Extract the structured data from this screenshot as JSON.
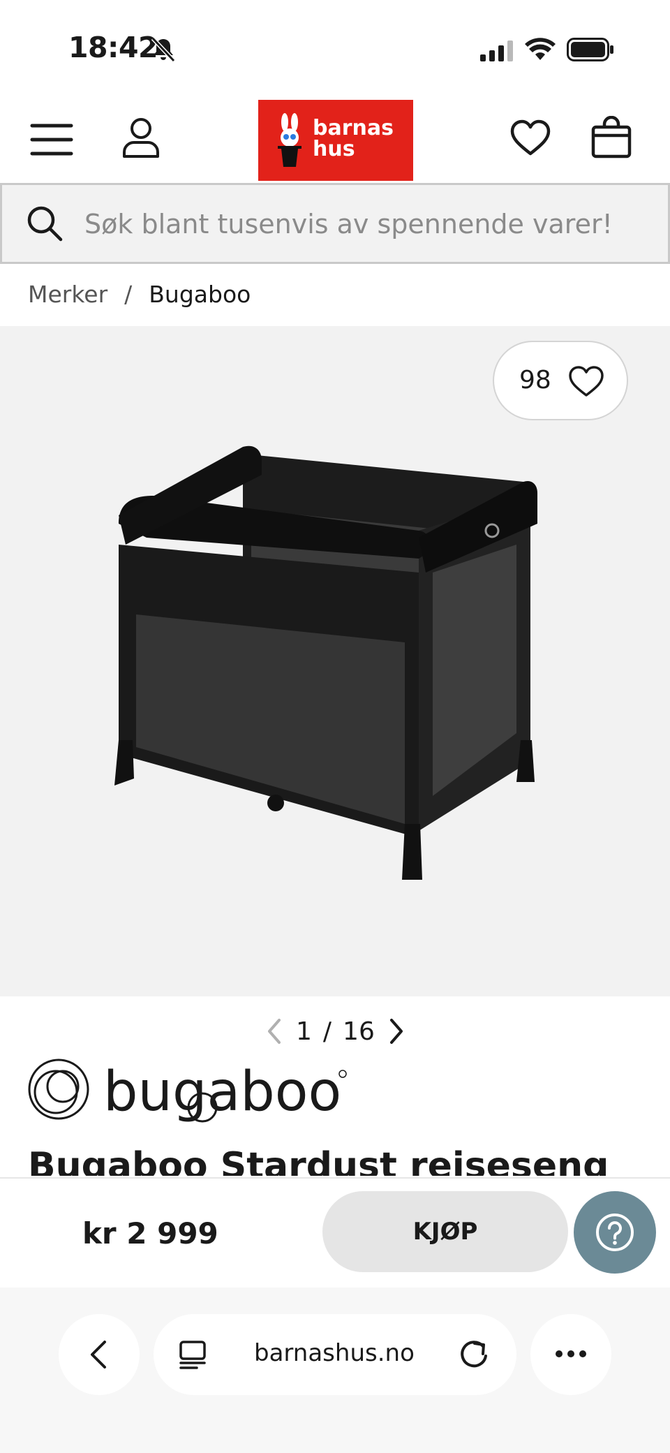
{
  "status_bar": {
    "time": "18:42"
  },
  "header": {
    "logo": {
      "line1": "barnas",
      "line2": "hus",
      "brand_color": "#e2221a"
    },
    "icons": [
      "menu-icon",
      "account-icon",
      "heart-icon",
      "shopping-bag-icon"
    ]
  },
  "search": {
    "placeholder": "Søk blant tusenvis av spennende varer!"
  },
  "breadcrumb": {
    "items": [
      "Merker",
      "Bugaboo"
    ],
    "separator": "/"
  },
  "gallery": {
    "favorite_count": "98",
    "current": "1",
    "separator": "/",
    "total": "16"
  },
  "product": {
    "brand": "bugaboo",
    "title": "Bugaboo Stardust reiseseng",
    "price": "kr 2 999"
  },
  "buy_bar": {
    "buy_label": "KJØP",
    "help_color": "#6b8a96"
  },
  "browser": {
    "url": "barnashus.no"
  }
}
